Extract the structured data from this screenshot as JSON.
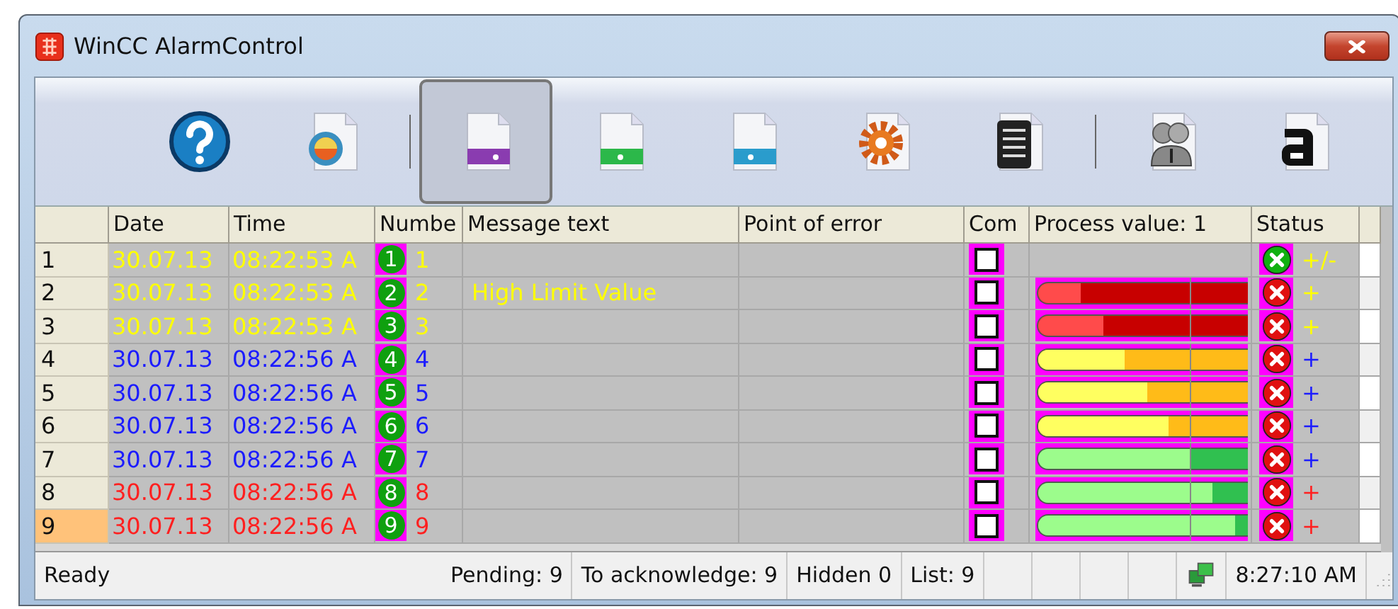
{
  "window": {
    "title": "WinCC AlarmControl"
  },
  "toolbar": {
    "items": [
      {
        "kind": "button",
        "pressed": false
      },
      {
        "kind": "button",
        "pressed": false
      },
      {
        "kind": "separator"
      },
      {
        "kind": "button",
        "pressed": true
      },
      {
        "kind": "button",
        "pressed": false
      },
      {
        "kind": "button",
        "pressed": false
      },
      {
        "kind": "button",
        "pressed": false
      },
      {
        "kind": "button",
        "pressed": false
      },
      {
        "kind": "separator"
      },
      {
        "kind": "button",
        "pressed": false
      },
      {
        "kind": "button",
        "pressed": false
      }
    ]
  },
  "table": {
    "columns": [
      "Date",
      "Time",
      "Numbe",
      "Message text",
      "Point of error",
      "Com",
      "Process value:  1",
      "Status"
    ],
    "rows": [
      {
        "index": "1",
        "selected": false,
        "color": "#ffff00",
        "date": "30.07.13",
        "time": "08:22:53 A",
        "badge": "1",
        "number": "1",
        "comment_checked": false,
        "active": false,
        "status": "+/-"
      },
      {
        "index": "2",
        "selected": false,
        "color": "#ffff00",
        "date": "30.07.13",
        "time": "08:22:53 A",
        "badge": "2",
        "number": "2",
        "message": "High Limit Value",
        "comment_checked": false,
        "bar": {
          "kind": "alarm",
          "level": 0.2
        },
        "active": true,
        "status": "+"
      },
      {
        "index": "3",
        "selected": false,
        "color": "#ffff00",
        "date": "30.07.13",
        "time": "08:22:53 A",
        "badge": "3",
        "number": "3",
        "comment_checked": false,
        "bar": {
          "kind": "alarm",
          "level": 0.31
        },
        "active": true,
        "status": "+"
      },
      {
        "index": "4",
        "selected": false,
        "color": "#1c1cff",
        "date": "30.07.13",
        "time": "08:22:56 A",
        "badge": "4",
        "number": "4",
        "comment_checked": false,
        "bar": {
          "kind": "warning",
          "level": 0.41
        },
        "active": true,
        "status": "+"
      },
      {
        "index": "5",
        "selected": false,
        "color": "#1c1cff",
        "date": "30.07.13",
        "time": "08:22:56 A",
        "badge": "5",
        "number": "5",
        "comment_checked": false,
        "bar": {
          "kind": "warning",
          "level": 0.52
        },
        "active": true,
        "status": "+"
      },
      {
        "index": "6",
        "selected": false,
        "color": "#1c1cff",
        "date": "30.07.13",
        "time": "08:22:56 A",
        "badge": "6",
        "number": "6",
        "comment_checked": false,
        "bar": {
          "kind": "warning",
          "level": 0.62
        },
        "active": true,
        "status": "+"
      },
      {
        "index": "7",
        "selected": false,
        "color": "#1c1cff",
        "date": "30.07.13",
        "time": "08:22:56 A",
        "badge": "7",
        "number": "7",
        "comment_checked": false,
        "bar": {
          "kind": "normal",
          "level": 0.73
        },
        "active": true,
        "status": "+"
      },
      {
        "index": "8",
        "selected": false,
        "color": "#ff2020",
        "date": "30.07.13",
        "time": "08:22:56 A",
        "badge": "8",
        "number": "8",
        "comment_checked": false,
        "bar": {
          "kind": "normal",
          "level": 0.83
        },
        "active": true,
        "status": "+"
      },
      {
        "index": "9",
        "selected": true,
        "color": "#ff2020",
        "date": "30.07.13",
        "time": "08:22:56 A",
        "badge": "9",
        "number": "9",
        "comment_checked": false,
        "bar": {
          "kind": "normal",
          "level": 0.94
        },
        "active": true,
        "status": "+"
      }
    ]
  },
  "status_bar": {
    "ready": "Ready",
    "pending": "Pending: 9",
    "to_acknowledge": "To acknowledge: 9",
    "hidden": "Hidden 0",
    "list": "List: 9",
    "time": "8:27:10 AM"
  }
}
